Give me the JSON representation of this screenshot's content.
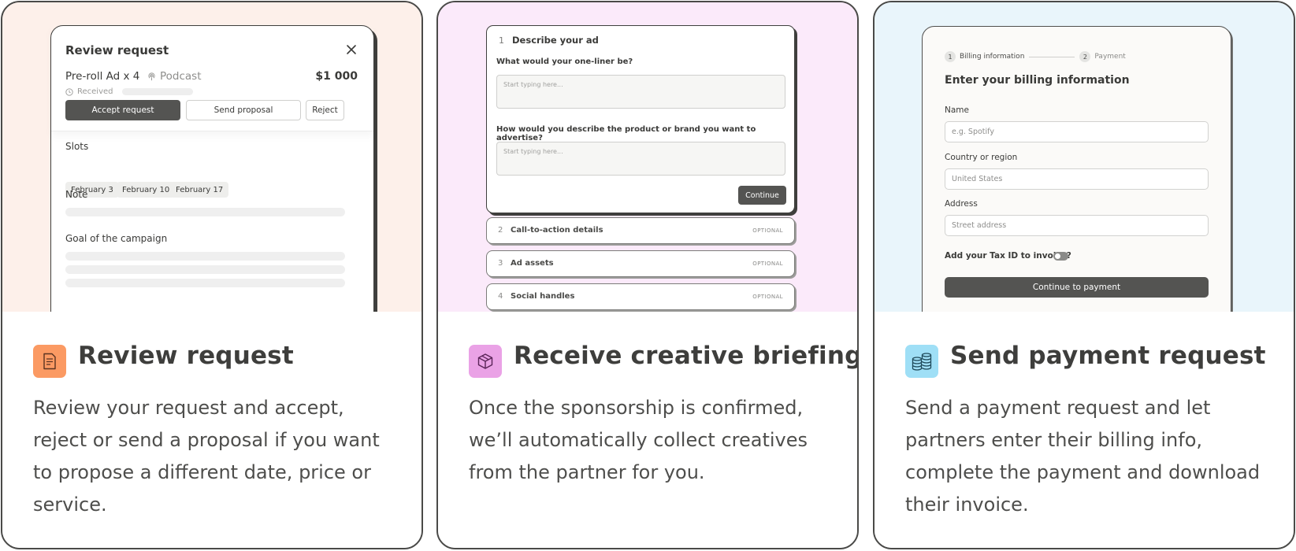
{
  "cards": [
    {
      "title": "Review request",
      "description": "Review your request and accept, reject or send a proposal if you want to propose a different date, price or service.",
      "icon": "document-icon",
      "icon_bg": "#fb9a63",
      "preview_bg": "#fdf0ea",
      "mock": {
        "title": "Review request",
        "product": "Pre-roll Ad x 4",
        "channel": "Podcast",
        "price": "$1 000",
        "status": "Received",
        "accept_label": "Accept request",
        "proposal_label": "Send proposal",
        "reject_label": "Reject",
        "slots_label": "Slots",
        "slots": [
          "February 3",
          "February 10",
          "February 17"
        ],
        "note_label": "Note",
        "goal_label": "Goal of the campaign"
      }
    },
    {
      "title": "Receive creative briefing",
      "description": "Once the sponsorship is confirmed, we’ll automatically collect creatives from the partner for you.",
      "icon": "box-icon",
      "icon_bg": "#eaa2e6",
      "preview_bg": "#fbeafa",
      "mock": {
        "step_num": "1",
        "step_title": "Describe your ad",
        "q1": "What would your one-liner be?",
        "q1_placeholder": "Start typing here...",
        "q2": "How would you describe the product or brand you want to advertise?",
        "q2_placeholder": "Start typing here...",
        "continue_label": "Continue",
        "rows": [
          {
            "num": "2",
            "label": "Call-to-action details",
            "tag": "OPTIONAL"
          },
          {
            "num": "3",
            "label": "Ad assets",
            "tag": "OPTIONAL"
          },
          {
            "num": "4",
            "label": "Social handles",
            "tag": "OPTIONAL"
          }
        ]
      }
    },
    {
      "title": "Send payment request",
      "description": "Send a payment request and let partners enter their billing info, complete the payment and download their invoice.",
      "icon": "coins-icon",
      "icon_bg": "#9fdff6",
      "preview_bg": "#e9f5fb",
      "mock": {
        "step1_num": "1",
        "step1": "Billing information",
        "step2_num": "2",
        "step2": "Payment",
        "title": "Enter your billing information",
        "name_label": "Name",
        "name_placeholder": "e.g. Spotify",
        "country_label": "Country or region",
        "country_value": "United States",
        "address_label": "Address",
        "address_placeholder": "Street address",
        "tax_label": "Add your Tax ID to invoice?",
        "tax_enabled": false,
        "continue_label": "Continue to payment"
      }
    }
  ]
}
